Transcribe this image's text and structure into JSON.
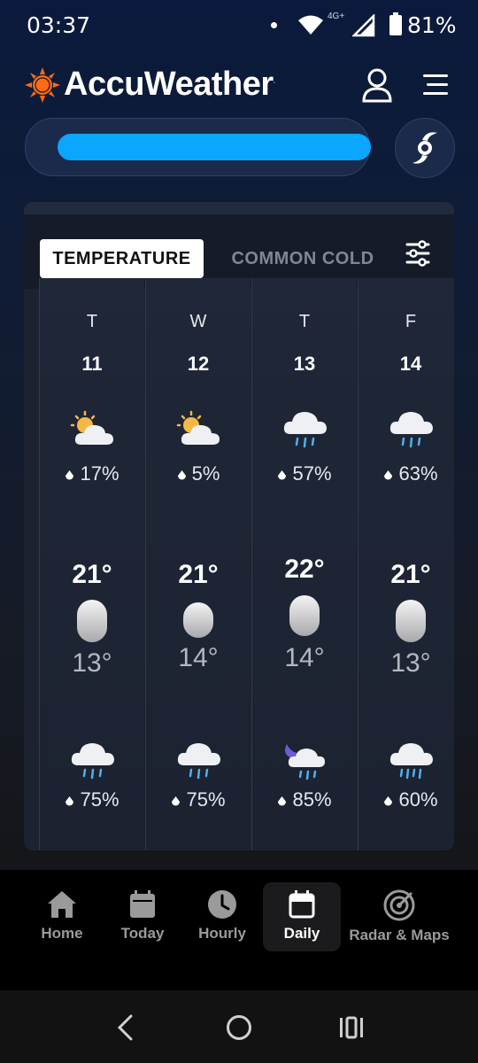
{
  "status_bar": {
    "time": "03:37",
    "network": "4G+",
    "battery": "81%"
  },
  "header": {
    "brand": "AccuWeather",
    "trademark": "."
  },
  "tabs": {
    "active": "TEMPERATURE",
    "inactive": "COMMON COLD"
  },
  "days": [
    {
      "dow": "T",
      "date": "11",
      "day_icon": "partly-sunny-icon",
      "day_precip": "17%",
      "high": "21°",
      "low": "13°",
      "night_icon": "rain-icon",
      "night_precip": "75%"
    },
    {
      "dow": "W",
      "date": "12",
      "day_icon": "partly-sunny-icon",
      "day_precip": "5%",
      "high": "21°",
      "low": "14°",
      "night_icon": "rain-icon",
      "night_precip": "75%"
    },
    {
      "dow": "T",
      "date": "13",
      "day_icon": "rain-icon",
      "day_precip": "57%",
      "high": "22°",
      "low": "14°",
      "night_icon": "moon-rain-icon",
      "night_precip": "85%"
    },
    {
      "dow": "F",
      "date": "14",
      "day_icon": "rain-icon",
      "day_precip": "63%",
      "high": "21°",
      "low": "13°",
      "night_icon": "rain-icon",
      "night_precip": "60%"
    }
  ],
  "nav": [
    {
      "label": "Home",
      "icon": "home-icon"
    },
    {
      "label": "Today",
      "icon": "calendar-icon"
    },
    {
      "label": "Hourly",
      "icon": "clock-icon"
    },
    {
      "label": "Daily",
      "icon": "calendar-icon",
      "active": true
    },
    {
      "label": "Radar & Maps",
      "icon": "radar-icon"
    }
  ],
  "colors": {
    "accent": "#0aa6ff",
    "logo": "#ff6a13",
    "background": "#0b1a3c"
  }
}
